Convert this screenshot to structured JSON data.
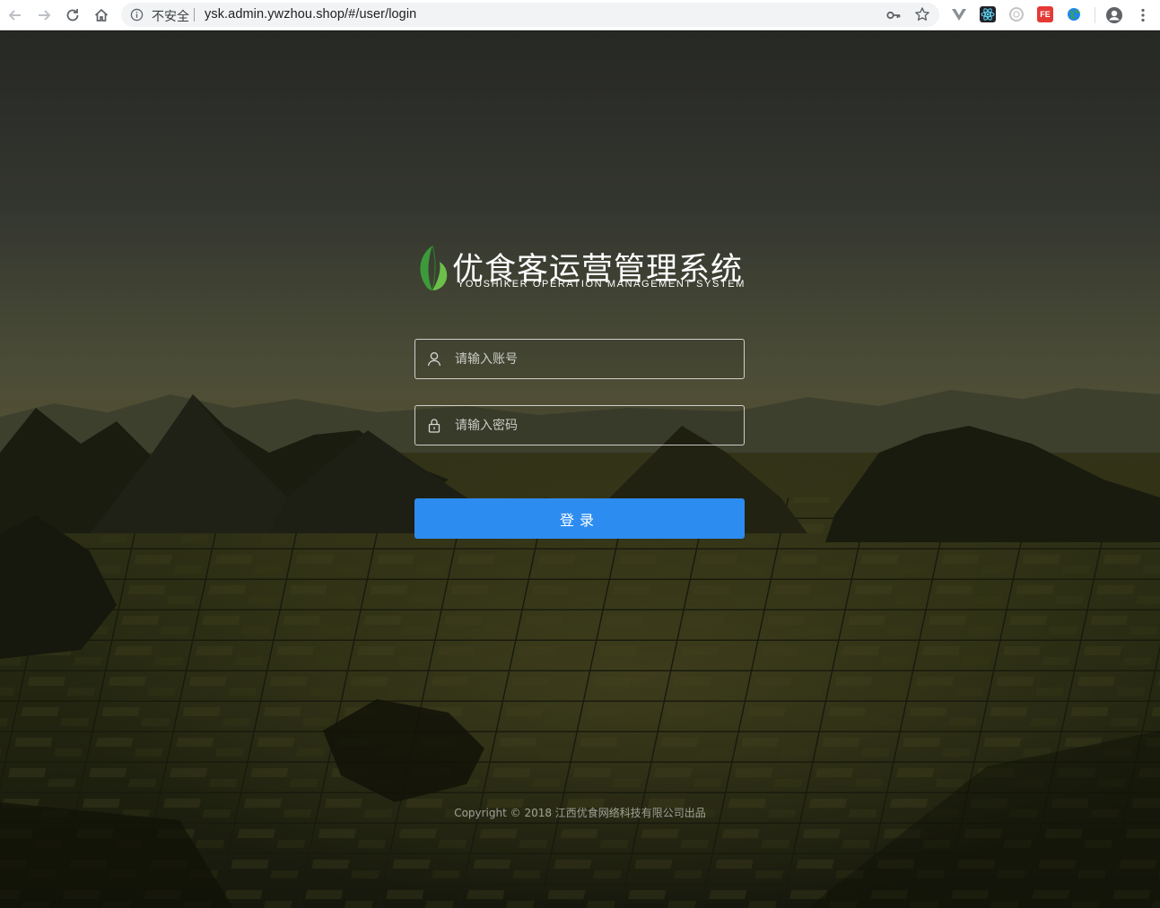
{
  "browser": {
    "security_label": "不安全",
    "url": "ysk.admin.ywzhou.shop/#/user/login",
    "extensions": [
      {
        "name": "vue-devtools",
        "color": "#5f6368"
      },
      {
        "name": "react-devtools",
        "color": "#20232a"
      },
      {
        "name": "ext-circle",
        "color": "#bdbdbd"
      },
      {
        "name": "fe-helper",
        "color": "#e53935",
        "label": "FE"
      },
      {
        "name": "ext-globe",
        "color": "#1e88e5"
      }
    ]
  },
  "login": {
    "title": "优食客运营管理系统",
    "subtitle": "YOUSHIKER OPERATION MANAGEMENT SYSTEM",
    "account_placeholder": "请输入账号",
    "account_value": "",
    "password_placeholder": "请输入密码",
    "password_value": "",
    "submit_label": "登录",
    "copyright": "Copyright © 2018 江西优食网络科技有限公司出品"
  },
  "colors": {
    "primary": "#2d8cf0",
    "leaf_dark": "#3c9a3a",
    "leaf_light": "#6cc04a"
  }
}
